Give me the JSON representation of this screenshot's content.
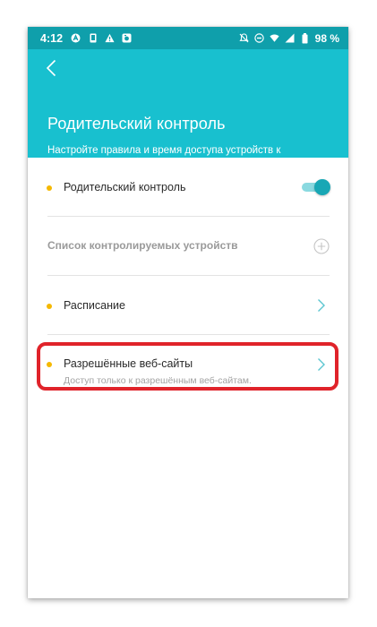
{
  "status_bar": {
    "time": "4:12",
    "battery_percent": "98 %",
    "left_icons": [
      "app-a-icon",
      "phone-icon",
      "warning-icon",
      "image-icon"
    ],
    "right_icons": [
      "notifications-off-icon",
      "do-not-disturb-icon",
      "wifi-icon",
      "cellular-signal-icon",
      "battery-icon"
    ]
  },
  "header": {
    "back_icon": "chevron-left-icon",
    "title": "Родительский контроль",
    "subtitle": "Настройте правила и время доступа устройств к определённым веб-сайтам."
  },
  "settings": {
    "parental_control": {
      "label": "Родительский контроль",
      "enabled": true
    },
    "device_list": {
      "label": "Список контролируемых устройств"
    },
    "schedule": {
      "label": "Расписание"
    },
    "allowed_sites": {
      "label": "Разрешённые веб-сайты",
      "description": "Доступ только к разрешённым веб-сайтам."
    }
  },
  "colors": {
    "status_bar": "#0f9fab",
    "header": "#18c0cf",
    "accent": "#18a7b5",
    "dot": "#f5b800",
    "highlight": "#e0232a"
  }
}
